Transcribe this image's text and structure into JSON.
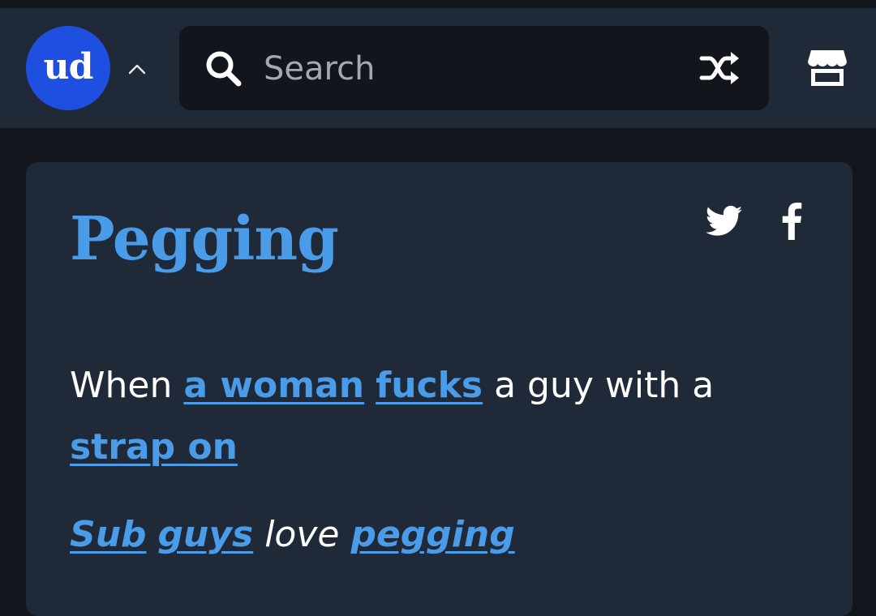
{
  "header": {
    "logo_text": "ud",
    "caret_icon": "chevron-up-icon",
    "search": {
      "placeholder": "Search",
      "value": ""
    },
    "icons": [
      "search-icon",
      "shuffle-icon",
      "store-icon"
    ]
  },
  "entry": {
    "word": "Pegging",
    "share_icons": [
      "twitter-icon",
      "facebook-icon"
    ],
    "definition": {
      "t1": "When ",
      "link1": "a woman",
      "t2": " ",
      "link2": "fucks",
      "t3": " a guy with a ",
      "link3": "strap on"
    },
    "example": {
      "link1": "Sub",
      "t1": " ",
      "link2": "guys",
      "t2": " love ",
      "link3": "pegging"
    }
  },
  "colors": {
    "background": "#13161d",
    "header_bg": "#1f2937",
    "card_bg": "#1f2937",
    "logo_bg": "#1f4fe0",
    "link": "#4a9be8",
    "text": "#ffffff"
  }
}
